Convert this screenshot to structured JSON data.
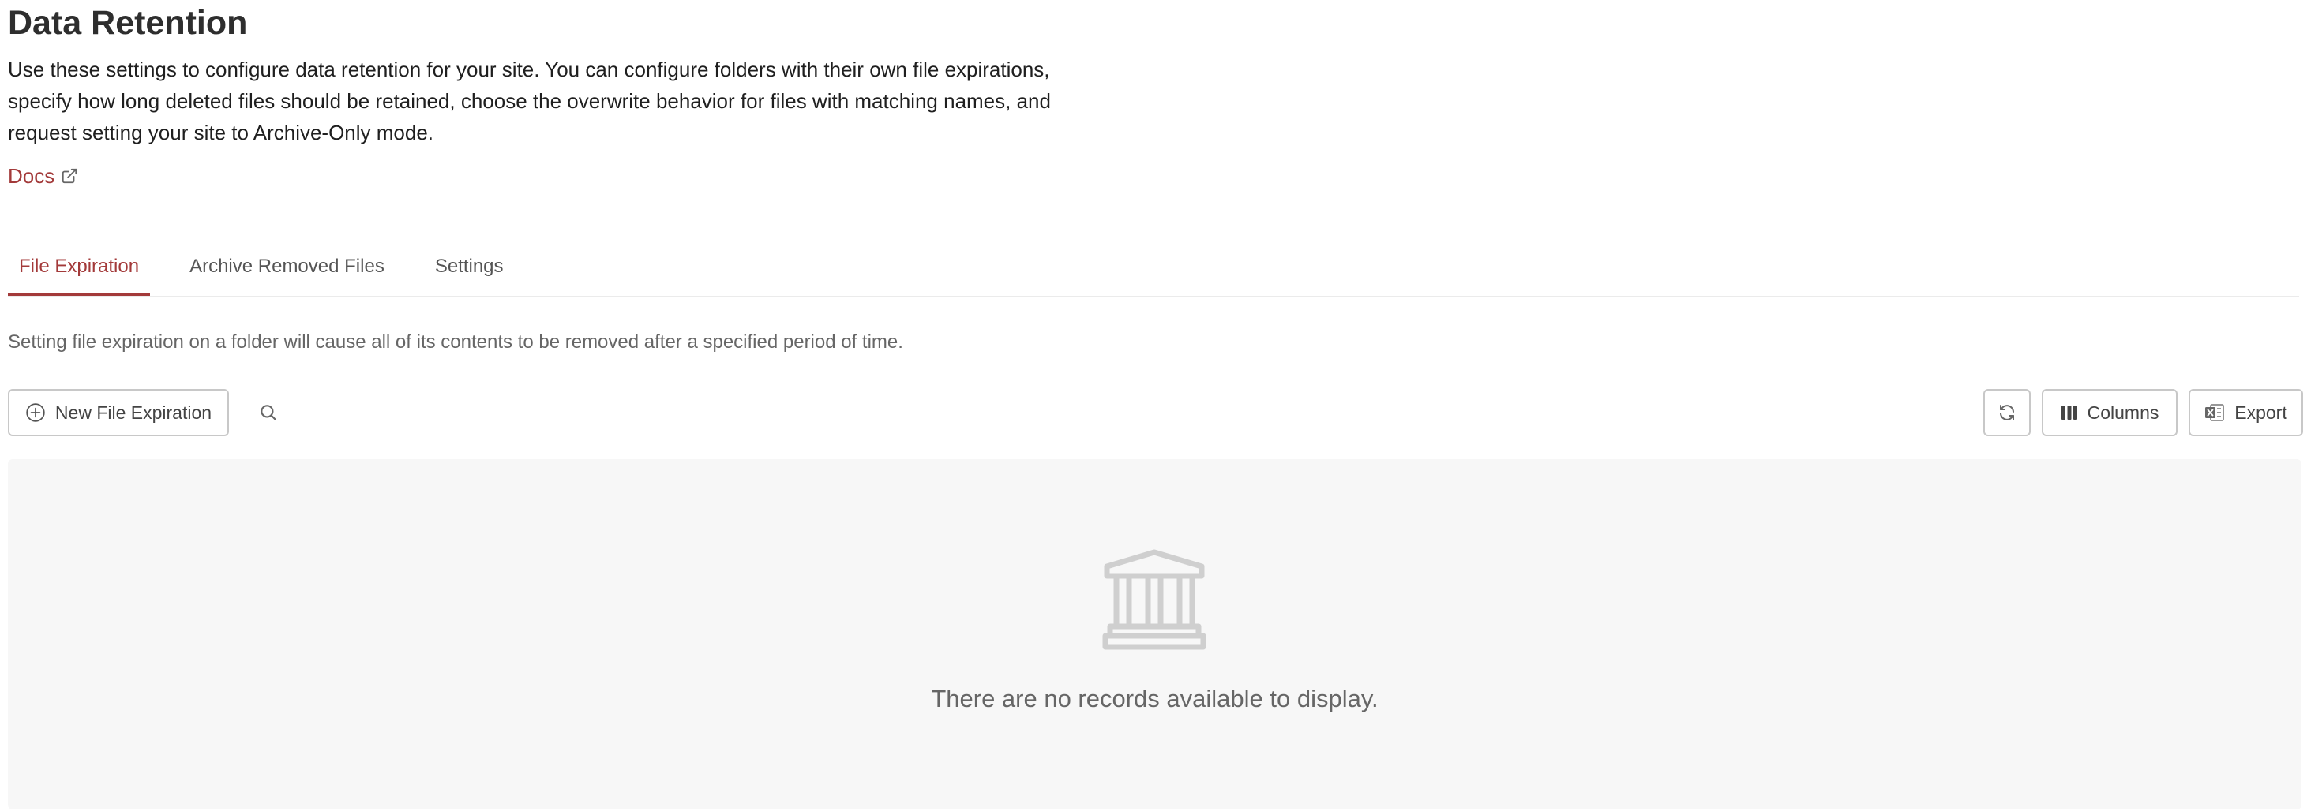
{
  "page": {
    "title": "Data Retention",
    "description": "Use these settings to configure data retention for your site. You can configure folders with their own file expirations, specify how long deleted files should be retained, choose the overwrite behavior for files with matching names, and request setting your site to Archive-Only mode.",
    "docs_link": "Docs"
  },
  "tabs": [
    {
      "label": "File Expiration",
      "active": true
    },
    {
      "label": "Archive Removed Files",
      "active": false
    },
    {
      "label": "Settings",
      "active": false
    }
  ],
  "file_expiration": {
    "help_text": "Setting file expiration on a folder will cause all of its contents to be removed after a specified period of time.",
    "toolbar": {
      "new_button": "New File Expiration",
      "columns_button": "Columns",
      "export_button": "Export"
    },
    "empty_message": "There are no records available to display."
  },
  "icons": {
    "docs": "external-link-icon",
    "new": "plus-circle-icon",
    "search": "search-icon",
    "refresh": "refresh-icon",
    "columns": "columns-icon",
    "export": "excel-export-icon",
    "empty": "bank-building-icon"
  },
  "colors": {
    "accent": "#a33a3a",
    "empty_bg": "#f7f7f7",
    "border": "#c8c8c8"
  }
}
